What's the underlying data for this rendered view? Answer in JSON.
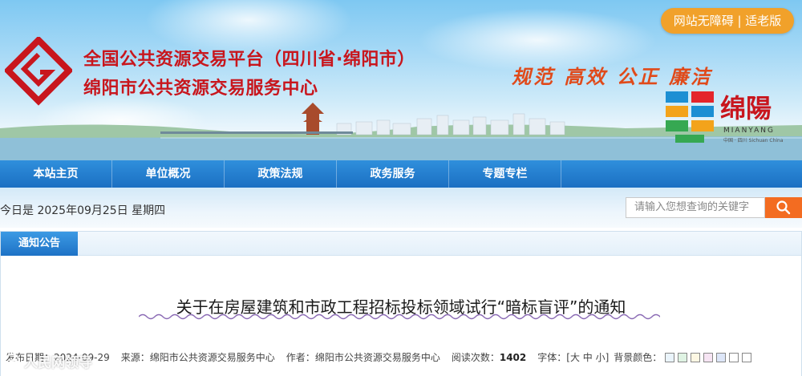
{
  "header": {
    "title_line1": "全国公共资源交易平台（四川省·绵阳市）",
    "title_line2": "绵阳市公共资源交易服务中心",
    "slogan": "规范 高效 公正 廉洁",
    "accessibility_button": "网站无障碍 | 适老版",
    "city_name": "绵陽",
    "city_en": "MIANYANG",
    "city_sub": "中国 · 四川 Sichuan China"
  },
  "nav": {
    "items": [
      "本站主页",
      "单位概况",
      "政策法规",
      "政务服务",
      "专题专栏"
    ]
  },
  "infobar": {
    "date_text": "今日是 2025年09月25日 星期四",
    "search_placeholder": "请输入您想查询的关键字"
  },
  "panel": {
    "tab_label": "通知公告"
  },
  "article": {
    "title": "关于在房屋建筑和市政工程招标投标领域试行“暗标盲评”的通知",
    "meta": {
      "publish_label": "发布日期：",
      "publish_date": "2024-09-29",
      "source_label": "来源：",
      "source": "绵阳市公共资源交易服务中心",
      "author_label": "作者：",
      "author": "绵阳市公共资源交易服务中心",
      "views_label": "阅读次数：",
      "views": "1402",
      "font_label": "字体：",
      "font_sizes": "[大 中 小]",
      "bg_label": "背景颜色："
    },
    "bg_colors": [
      "#eaf4fb",
      "#dff3e3",
      "#fdf7e3",
      "#f6e4f3",
      "#dde6f8",
      "#ffffff",
      "#ffffff"
    ]
  },
  "watermark": "人民网领导"
}
